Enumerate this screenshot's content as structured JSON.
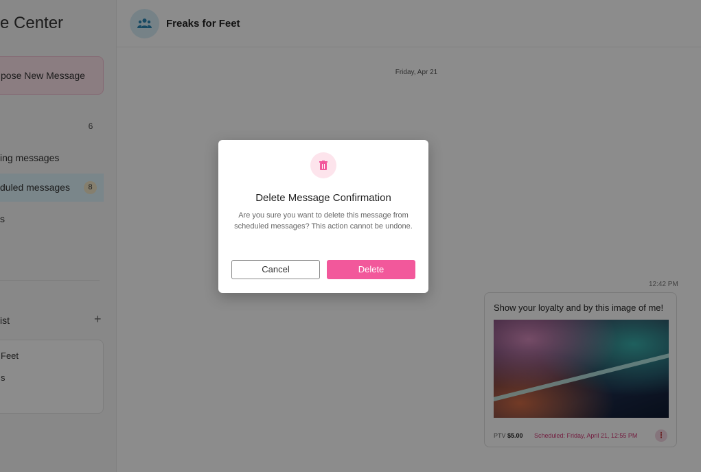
{
  "sidebar": {
    "title": "e Center",
    "compose_label": "pose New Message",
    "count_top": "6",
    "items": [
      {
        "label": "ing messages"
      },
      {
        "label": "duled messages",
        "badge": "8"
      },
      {
        "label": "s"
      }
    ],
    "list_header": "ist",
    "list_items": [
      "Feet",
      "s"
    ]
  },
  "header": {
    "title": "Freaks for Feet"
  },
  "chat": {
    "date": "Friday, Apr 21",
    "time": "12:42 PM",
    "message_text": "Show your loyalty and by this image of me!",
    "ptv_label": "PTV",
    "ptv_price": "$5.00",
    "scheduled": "Scheduled: Friday, April 21, 12:55 PM"
  },
  "modal": {
    "title": "Delete Message Confirmation",
    "body": "Are you sure you want to delete this message from scheduled messages? This action cannot be undone.",
    "cancel_label": "Cancel",
    "delete_label": "Delete"
  },
  "colors": {
    "accent": "#f2589b",
    "active_item": "#dff4fb",
    "scheduled_text": "#d23a77"
  }
}
